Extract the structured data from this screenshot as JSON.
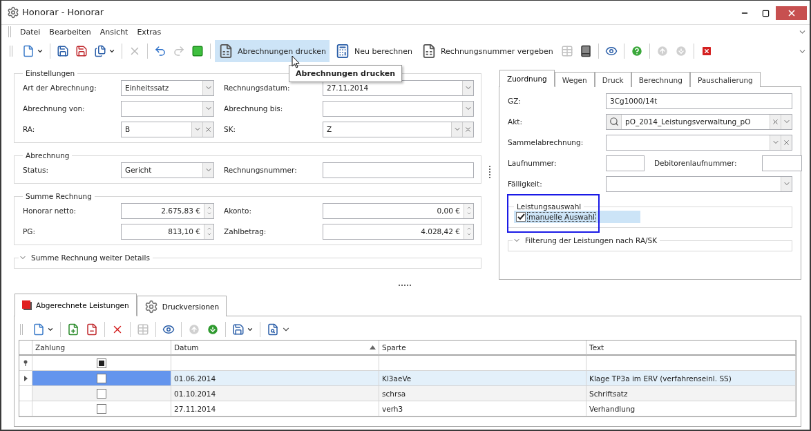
{
  "window": {
    "title": "Honorar - Honorar"
  },
  "menu": [
    {
      "label": "Datei"
    },
    {
      "label": "Bearbeiten"
    },
    {
      "label": "Ansicht"
    },
    {
      "label": "Extras"
    }
  ],
  "toolbar": [
    {
      "kind": "icon",
      "disabled": false
    },
    {
      "kind": "separator"
    },
    {
      "kind": "icon",
      "disabled": false
    },
    {
      "kind": "icon",
      "disabled": false
    },
    {
      "kind": "icon",
      "disabled": false
    },
    {
      "kind": "separator"
    },
    {
      "kind": "icon",
      "disabled": true
    },
    {
      "kind": "separator"
    },
    {
      "kind": "icon",
      "disabled": false
    },
    {
      "kind": "icon",
      "disabled": true
    },
    {
      "kind": "icon",
      "disabled": false
    },
    {
      "kind": "separator"
    },
    {
      "kind": "button",
      "label": "Abrechnungen drucken",
      "hovered": true,
      "tooltip": "Abrechnungen drucken"
    },
    {
      "kind": "button",
      "label": "Neu berechnen",
      "hovered": false
    },
    {
      "kind": "button",
      "label": "Rechnungsnummer vergeben",
      "hovered": false
    },
    {
      "kind": "icon",
      "disabled": true
    },
    {
      "kind": "icon",
      "disabled": false
    },
    {
      "kind": "separator"
    },
    {
      "kind": "icon",
      "disabled": false
    },
    {
      "kind": "separator"
    },
    {
      "kind": "icon",
      "disabled": false
    },
    {
      "kind": "separator"
    },
    {
      "kind": "icon",
      "disabled": true
    },
    {
      "kind": "icon",
      "disabled": true
    },
    {
      "kind": "separator"
    },
    {
      "kind": "icon",
      "disabled": false
    }
  ],
  "groups": [
    {
      "title": "Einstellungen",
      "rows": [
        [
          {
            "label": "Art der Abrechnung:",
            "value": "Einheitssatz",
            "kind": "combo"
          },
          {
            "label": "Rechnungsdatum:",
            "value": "27.11.2014",
            "kind": "combo"
          }
        ],
        [
          {
            "label": "Abrechnung von:",
            "kind": "combo"
          },
          {
            "label": "Abrechnung bis:",
            "kind": "combo"
          }
        ],
        [
          {
            "label": "RA:",
            "value": "B",
            "kind": "clear-combo"
          },
          {
            "label": "SK:",
            "value": "Z",
            "kind": "clear-combo"
          }
        ]
      ]
    },
    {
      "title": "Abrechnung",
      "rows": [
        [
          {
            "label": "Status:",
            "value": "Gericht",
            "kind": "combo"
          },
          {
            "label": "Rechnungsnummer:",
            "kind": "text"
          }
        ]
      ]
    },
    {
      "title": "Summe Rechnung",
      "rows": [
        [
          {
            "label": "Honorar netto:",
            "value": "2.675,83 €",
            "kind": "spin"
          },
          {
            "label": "Akonto:",
            "value": "0,00 €",
            "kind": "spin"
          }
        ],
        [
          {
            "label": "PG:",
            "value": "813,10 €",
            "kind": "spin"
          },
          {
            "label": "Zahlbetrag:",
            "value": "4.028,42 €",
            "kind": "spin"
          }
        ]
      ]
    }
  ],
  "details_group": {
    "title": "Summe Rechnung weiter Details",
    "expanded": false
  },
  "right_panel": {
    "tabs": [
      {
        "label": "Zuordnung",
        "selected": true
      },
      {
        "label": "Wegen",
        "selected": false
      },
      {
        "label": "Druck",
        "selected": false
      },
      {
        "label": "Berechnung",
        "selected": false
      },
      {
        "label": "Pauschalierung",
        "selected": false
      }
    ],
    "fields": [
      {
        "kind": "text",
        "label": "GZ:",
        "value": "3Cg1000/14t"
      },
      {
        "kind": "search",
        "label": "Akt:",
        "value": "pO_2014_Leistungsverwaltung_pO"
      },
      {
        "kind": "clear-combo",
        "label": "Sammelabrechnung:"
      },
      {
        "kind": "pair",
        "label": "Laufnummer:",
        "label2": "Debitorenlaufnummer:"
      },
      {
        "kind": "combo",
        "label": "Fälligkeit:"
      }
    ],
    "selection_group": {
      "title": "Leistungsauswahl",
      "checkbox": {
        "label": "manuelle Auswahl",
        "checked": true
      }
    },
    "filter_group": {
      "title": "Filterung der Leistungen nach RA/SK",
      "expanded": false
    }
  },
  "bottom_tabs": [
    {
      "label": "Abgerechnete Leistungen",
      "selected": true
    },
    {
      "label": "Druckversionen",
      "selected": false
    }
  ],
  "bottom_toolbar": [
    {
      "kind": "icon",
      "disabled": false
    },
    {
      "kind": "separator"
    },
    {
      "kind": "icon",
      "disabled": false
    },
    {
      "kind": "icon",
      "disabled": false
    },
    {
      "kind": "separator"
    },
    {
      "kind": "icon",
      "disabled": false
    },
    {
      "kind": "separator"
    },
    {
      "kind": "icon",
      "disabled": true
    },
    {
      "kind": "separator"
    },
    {
      "kind": "icon",
      "disabled": false
    },
    {
      "kind": "separator"
    },
    {
      "kind": "icon",
      "disabled": true
    },
    {
      "kind": "icon",
      "disabled": false
    },
    {
      "kind": "separator"
    },
    {
      "kind": "icon",
      "disabled": false
    },
    {
      "kind": "separator"
    },
    {
      "kind": "icon",
      "disabled": false
    }
  ],
  "table": {
    "columns": [
      {
        "label": "Zahlung",
        "sorted": false
      },
      {
        "label": "Datum",
        "sorted": true
      },
      {
        "label": "Sparte",
        "sorted": false
      },
      {
        "label": "Text",
        "sorted": false
      }
    ],
    "filter_row": {
      "partial": true
    },
    "rows": [
      {
        "zahlung": false,
        "datum": "01.06.2014",
        "sparte": "Kl3aeVe",
        "text": "Klage TP3a im ERV (verfahrenseinl. SS)",
        "selected": true
      },
      {
        "zahlung": false,
        "datum": "01.10.2014",
        "sparte": "schrsa",
        "text": "Schriftsatz",
        "selected": false
      },
      {
        "zahlung": false,
        "datum": "27.11.2014",
        "sparte": "verh3",
        "text": "Verhandlung",
        "selected": false
      }
    ]
  }
}
